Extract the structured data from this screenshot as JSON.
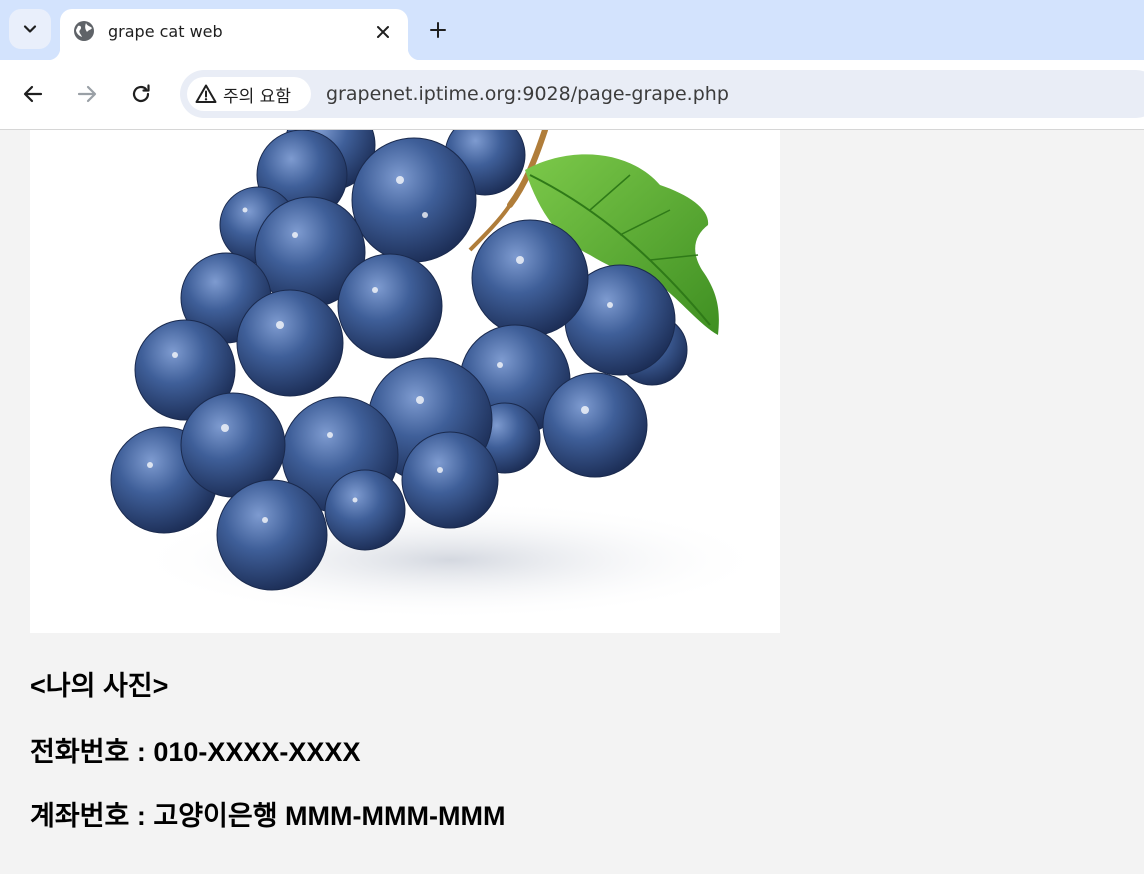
{
  "browser": {
    "tab": {
      "title": "grape cat web"
    },
    "security_chip": {
      "label": "주의 요함"
    },
    "url": "grapenet.iptime.org:9028/page-grape.php",
    "icons": {
      "tab_search": "chevron-down-icon",
      "favicon": "globe-icon",
      "close": "close-icon",
      "new_tab": "plus-icon",
      "back": "arrow-left-icon",
      "forward": "arrow-right-icon",
      "reload": "reload-icon",
      "warning": "warning-icon"
    }
  },
  "page": {
    "photo": {
      "subject": "grapes-photo"
    },
    "caption": "<나의 사진>",
    "phone": "전화번호 : 010-XXXX-XXXX",
    "account": "계좌번호 : 고양이은행 MMM-MMM-MMM"
  },
  "colors": {
    "tabstrip": "#d3e3fd",
    "omnibox": "#e9edf6",
    "page_background": "#f3f3f3",
    "grape": "#3a5a93",
    "leaf": "#5fb33a"
  }
}
